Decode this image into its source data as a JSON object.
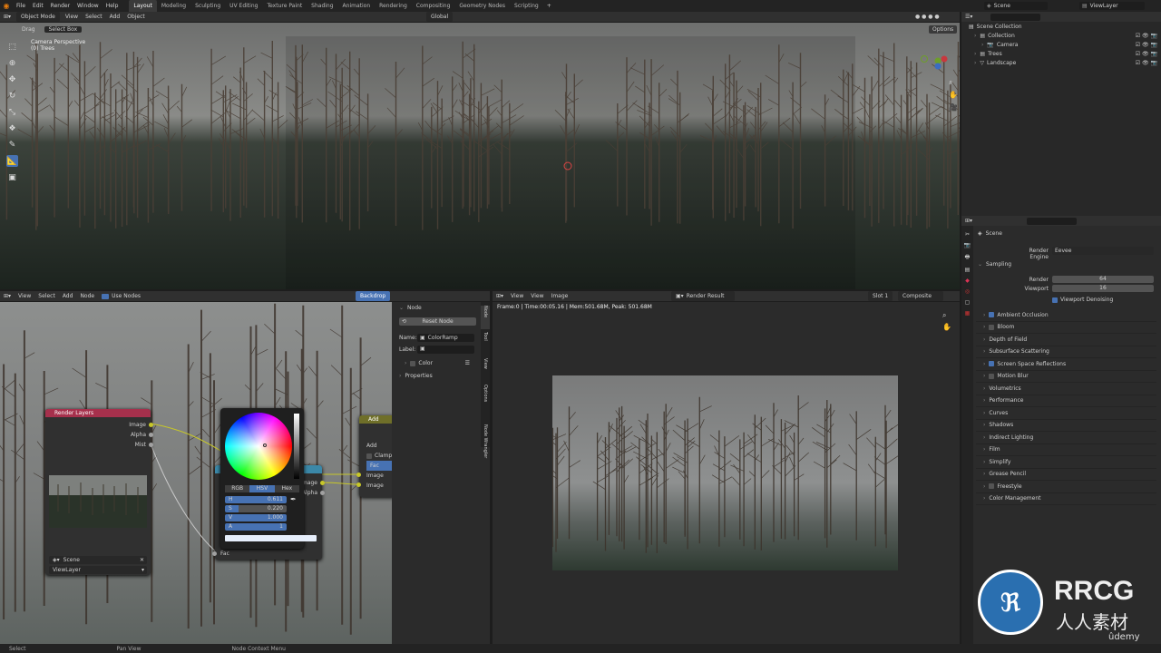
{
  "topbar": {
    "menus": [
      "File",
      "Edit",
      "Render",
      "Window",
      "Help"
    ],
    "workspaces": [
      "Layout",
      "Modeling",
      "Sculpting",
      "UV Editing",
      "Texture Paint",
      "Shading",
      "Animation",
      "Rendering",
      "Compositing",
      "Geometry Nodes",
      "Scripting"
    ],
    "add": "+",
    "scene": "Scene",
    "view_layer": "ViewLayer"
  },
  "viewport": {
    "mode": "Object Mode",
    "menus": [
      "View",
      "Select",
      "Add",
      "Object"
    ],
    "orientation": "Global",
    "drag_label": "Drag",
    "select_box": "Select Box",
    "camera_label": "Camera Perspective",
    "collection_label": "(0) Trees",
    "options": "Options"
  },
  "outliner": {
    "root": "Scene Collection",
    "items": [
      {
        "name": "Collection",
        "indent": 0
      },
      {
        "name": "Camera",
        "indent": 1
      },
      {
        "name": "Trees",
        "indent": 0
      },
      {
        "name": "Landscape",
        "indent": 0
      }
    ]
  },
  "properties": {
    "scene_name": "Scene",
    "render_engine_label": "Render Engine",
    "render_engine": "Eevee",
    "sampling": "Sampling",
    "render_label": "Render",
    "render_value": "64",
    "viewport_label": "Viewport",
    "viewport_value": "16",
    "denoise": "Viewport Denoising",
    "sections": [
      {
        "label": "Ambient Occlusion",
        "check": true
      },
      {
        "label": "Bloom",
        "check": false
      },
      {
        "label": "Depth of Field",
        "check": null
      },
      {
        "label": "Subsurface Scattering",
        "check": null
      },
      {
        "label": "Screen Space Reflections",
        "check": true
      },
      {
        "label": "Motion Blur",
        "check": false
      },
      {
        "label": "Volumetrics",
        "check": null
      },
      {
        "label": "Performance",
        "check": null
      },
      {
        "label": "Curves",
        "check": null
      },
      {
        "label": "Shadows",
        "check": null
      },
      {
        "label": "Indirect Lighting",
        "check": null
      },
      {
        "label": "Film",
        "check": null
      },
      {
        "label": "Simplify",
        "check": null
      },
      {
        "label": "Grease Pencil",
        "check": null
      },
      {
        "label": "Freestyle",
        "check": false
      },
      {
        "label": "Color Management",
        "check": null
      }
    ]
  },
  "node_editor": {
    "menus": [
      "View",
      "Select",
      "Add",
      "Node"
    ],
    "use_nodes": "Use Nodes",
    "backdrop": "Backdrop",
    "render_layers": {
      "title": "Render Layers",
      "outputs": [
        "Image",
        "Alpha",
        "Mist"
      ],
      "scene": "Scene",
      "view_layer": "ViewLayer"
    },
    "colorramp": {
      "outputs": [
        "Image",
        "Alpha"
      ],
      "input": "Fac"
    },
    "add_node": {
      "title": "Add",
      "items": [
        "Add",
        "Clamp",
        "Fac",
        "Image",
        "Image"
      ]
    },
    "picker": {
      "tabs": [
        "RGB",
        "HSV",
        "Hex"
      ],
      "h_label": "H",
      "h": "0.611",
      "s_label": "S",
      "s": "0.220",
      "v_label": "V",
      "v": "1.000",
      "a_label": "A",
      "a": "1"
    }
  },
  "sidebar": {
    "section": "Node",
    "reset": "Reset Node",
    "name_label": "Name:",
    "name_value": "ColorRamp",
    "label_label": "Label:",
    "color": "Color",
    "properties": "Properties",
    "tabs": [
      "Node",
      "Tool",
      "View",
      "Options",
      "Node Wrangler"
    ]
  },
  "image_editor": {
    "menus": [
      "View",
      "View",
      "Image"
    ],
    "image_name": "Render Result",
    "slot": "Slot 1",
    "pass": "Composite",
    "info": "Frame:0 | Time:00:05.16 | Mem:501.68M, Peak: 501.68M"
  },
  "statusbar": {
    "items": [
      "Select",
      "Pan View",
      "Node Context Menu"
    ]
  },
  "watermark": {
    "text": "RRCG",
    "sub": "人人素材",
    "udemy": "ûdemy"
  }
}
